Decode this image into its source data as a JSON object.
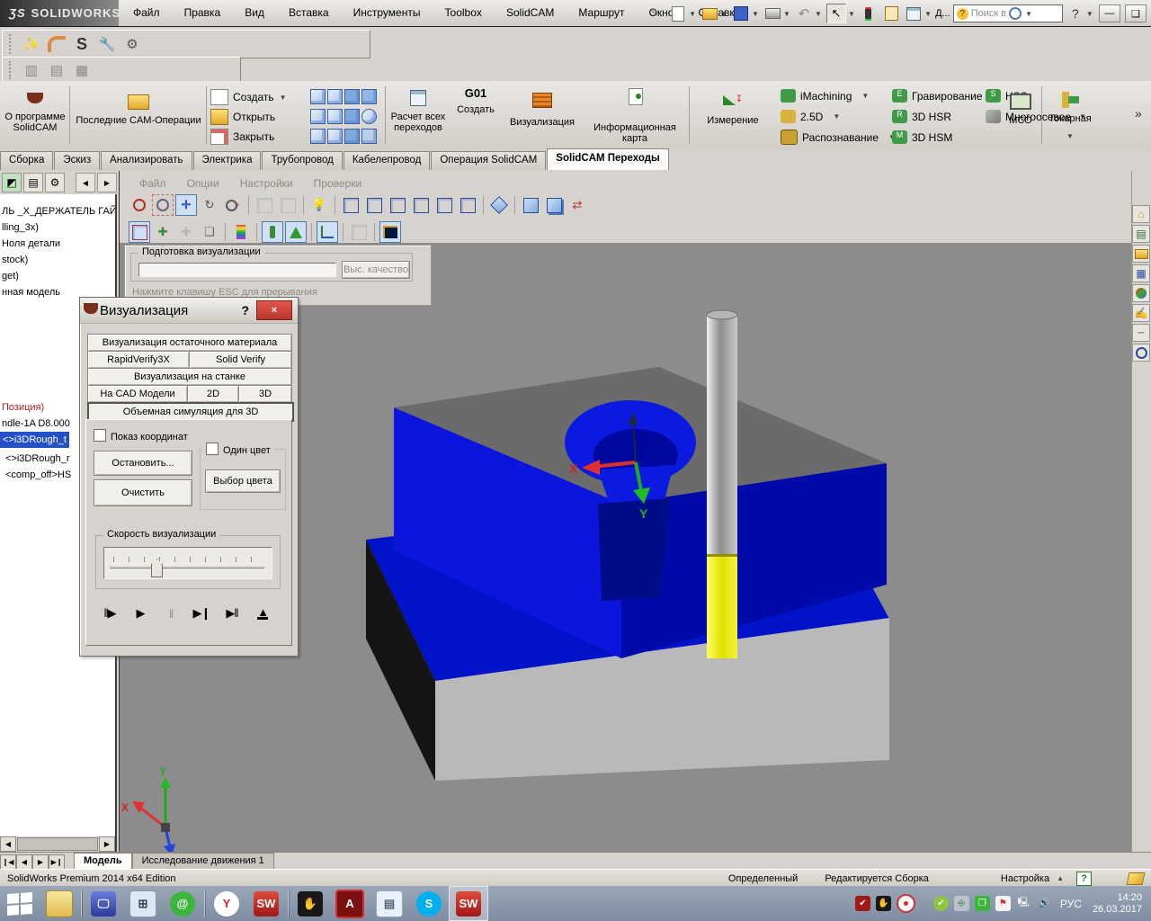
{
  "titlebar": {
    "logo": "SOLIDWORKS",
    "menus": [
      "Файл",
      "Правка",
      "Вид",
      "Вставка",
      "Инструменты",
      "Toolbox",
      "SolidCAM",
      "Маршрут",
      "Окно",
      "Справка"
    ],
    "doc_item": "Д...",
    "search": "Поиск в"
  },
  "ribbon": {
    "about": "О программе SolidCAM",
    "recent": "Последние CAM-Операции",
    "file_new": "Создать",
    "file_open": "Открыть",
    "file_close": "Закрыть",
    "calc": "Расчет всех переходов",
    "gcode_tag": "G01",
    "gcode": "Создать",
    "visual": "Визуализация",
    "infocard": "Информационная карта",
    "measure": "Измерение",
    "col1": [
      "iMachining",
      "2.5D",
      "Распознавание"
    ],
    "col2": [
      "Гравирование",
      "3D HSR",
      "3D HSM"
    ],
    "col3": [
      "HSS",
      "Многоосевое"
    ],
    "mco": "МСО",
    "turning": "Токарная",
    "more": "»"
  },
  "tabs": [
    "Сборка",
    "Эскиз",
    "Анализировать",
    "Электрика",
    "Трубопровод",
    "Кабелепровод",
    "Операция SolidCAM",
    "SolidCAM Переходы"
  ],
  "sim": {
    "menus": [
      "Файл",
      "Опции",
      "Настройки",
      "Проверки"
    ]
  },
  "tree": {
    "block1": [
      "ЛЬ _X_ДЕРЖАТЕЛЬ ГАЙК",
      "lling_3x)",
      "Ноля детали",
      "stock)",
      "get)",
      "нная модель"
    ],
    "block2": [
      "Позиция)",
      "ndle-1A D8.000",
      "<>i3DRough_t",
      "<>i3DRough_r",
      "<comp_off>HS"
    ]
  },
  "progress": {
    "title": "Подготовка визуализации",
    "quality": "Выс. качество",
    "hint": "Нажмите клавишу ESC для прерывания"
  },
  "dialog": {
    "title": "Визуализация",
    "help": "?",
    "close": "×",
    "tabs": {
      "residual": "Визуализация остаточного материала",
      "rapid": "RapidVerify3X",
      "solid": "Solid Verify",
      "machine": "Визуализация на станке",
      "cad": "На CAD Модели",
      "two_d": "2D",
      "three_d": "3D",
      "volume": "Объемная симуляция для 3D"
    },
    "show_coords": "Показ координат",
    "stop": "Остановить...",
    "clear": "Очистить",
    "one_color": "Один цвет",
    "pick_color": "Выбор цвета",
    "speed": "Скорость визуализации"
  },
  "viewport": {
    "axis": {
      "x": "X",
      "y": "Y",
      "z": "Z"
    }
  },
  "bottom_tabs": {
    "model": "Модель",
    "motion": "Исследование движения 1"
  },
  "statusbar": {
    "edition": "SolidWorks Premium 2014 x64 Edition",
    "state": "Определенный",
    "mode": "Редактируется Сборка",
    "config": "Настройка"
  },
  "taskbar": {
    "lang": "РУС",
    "time": "14:20",
    "date": "26.03.2017"
  },
  "colors": {
    "model_bright_blue": "#0b1ae0",
    "model_dark_blue": "#000d86",
    "tool_yellow": "#ecec00",
    "top_face_gray": "#6b6b6b",
    "selection_blue": "#2450c8"
  }
}
